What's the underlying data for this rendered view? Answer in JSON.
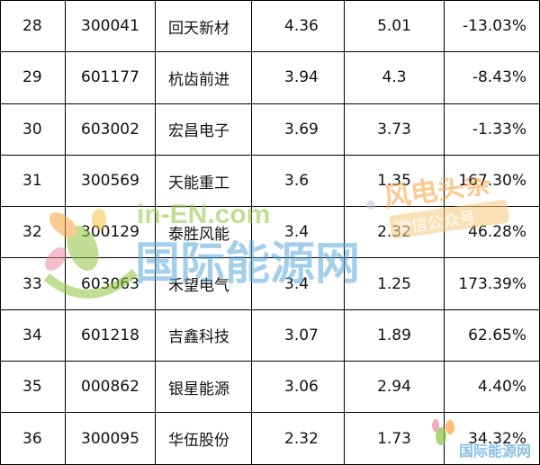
{
  "rows": [
    {
      "rank": "28",
      "code": "300041",
      "name": "回天新材",
      "v1": "4.36",
      "v2": "5.01",
      "chg": "-13.03%"
    },
    {
      "rank": "29",
      "code": "601177",
      "name": "杭齿前进",
      "v1": "3.94",
      "v2": "4.3",
      "chg": "-8.43%"
    },
    {
      "rank": "30",
      "code": "603002",
      "name": "宏昌电子",
      "v1": "3.69",
      "v2": "3.73",
      "chg": "-1.33%"
    },
    {
      "rank": "31",
      "code": "300569",
      "name": "天能重工",
      "v1": "3.6",
      "v2": "1.35",
      "chg": "167.30%"
    },
    {
      "rank": "32",
      "code": "300129",
      "name": "泰胜风能",
      "v1": "3.4",
      "v2": "2.32",
      "chg": "46.28%"
    },
    {
      "rank": "33",
      "code": "603063",
      "name": "禾望电气",
      "v1": "3.4",
      "v2": "1.25",
      "chg": "173.39%"
    },
    {
      "rank": "34",
      "code": "601218",
      "name": "吉鑫科技",
      "v1": "3.07",
      "v2": "1.89",
      "chg": "62.65%"
    },
    {
      "rank": "35",
      "code": "000862",
      "name": "银星能源",
      "v1": "3.06",
      "v2": "2.94",
      "chg": "4.40%"
    },
    {
      "rank": "36",
      "code": "300095",
      "name": "华伍股份",
      "v1": "2.32",
      "v2": "1.73",
      "chg": "34.32%"
    }
  ],
  "watermark": {
    "site": "in-EN.com",
    "name": "国际能源网",
    "wechat_title": "风电头条",
    "wechat_sub": "微信公众号",
    "corner_name": "国际能源网",
    "colors": {
      "green": "#8dc63f",
      "orange": "#f7a23b",
      "blue": "#4fa3d8",
      "pink": "#e88aa3"
    }
  }
}
